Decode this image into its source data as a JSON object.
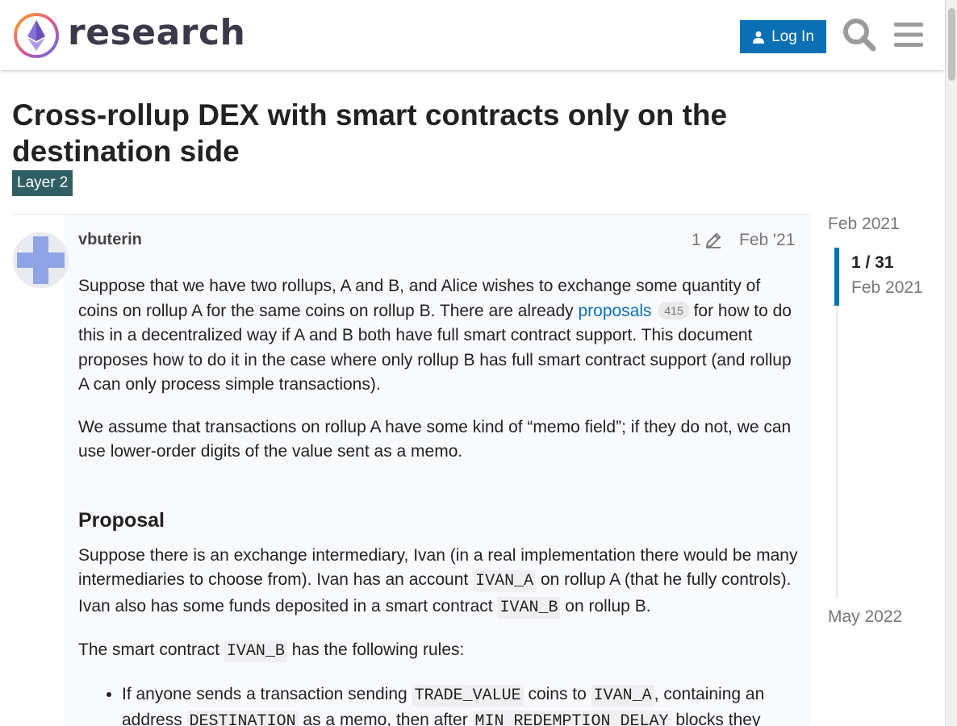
{
  "header": {
    "site_name": "research",
    "login_label": "Log In"
  },
  "topic": {
    "title": "Cross-rollup DEX with smart contracts only on the destination side",
    "category": "Layer 2",
    "category_color": "#2f5f63"
  },
  "post": {
    "username": "vbuterin",
    "edit_count": "1",
    "date": "Feb '21",
    "p1_a": "Suppose that we have two rollups, A and B, and Alice wishes to exchange some quantity of coins on rollup A for the same coins on rollup B. There are already ",
    "p1_link": "proposals",
    "p1_clicks": "415",
    "p1_b": " for how to do this in a decentralized way if A and B both have full smart contract support. This document proposes how to do it in the case where only rollup B has full smart contract support (and rollup A can only process simple transactions).",
    "p2": "We assume that transactions on rollup A have some kind of “memo field”; if they do not, we can use lower-order digits of the value sent as a memo.",
    "heading": "Proposal",
    "p3_a": "Suppose there is an exchange intermediary, Ivan (in a real implementation there would be many intermediaries to choose from). Ivan has an account ",
    "p3_code1": "IVAN_A",
    "p3_b": " on rollup A (that he fully controls). Ivan also has some funds deposited in a smart contract ",
    "p3_code2": "IVAN_B",
    "p3_c": " on rollup B.",
    "p4_a": "The smart contract ",
    "p4_code": "IVAN_B",
    "p4_b": " has the following rules:",
    "li1_a": "If anyone sends a transaction sending ",
    "li1_code1": "TRADE_VALUE",
    "li1_b": " coins to ",
    "li1_code2": "IVAN_A",
    "li1_c": ", containing an address ",
    "li1_code3": "DESTINATION",
    "li1_d": " as a memo, then after ",
    "li1_code4": "MIN_REDEMPTION_DELAY",
    "li1_e": " blocks they"
  },
  "timeline": {
    "start": "Feb 2021",
    "position": "1 / 31",
    "position_date": "Feb 2021",
    "end": "May 2022"
  },
  "colors": {
    "accent": "#0b6fb6",
    "post_bg": "#f8fafd"
  },
  "icons": {
    "login": "user-icon",
    "search": "search-icon",
    "menu": "hamburger-menu-icon",
    "edit": "pencil-icon"
  }
}
